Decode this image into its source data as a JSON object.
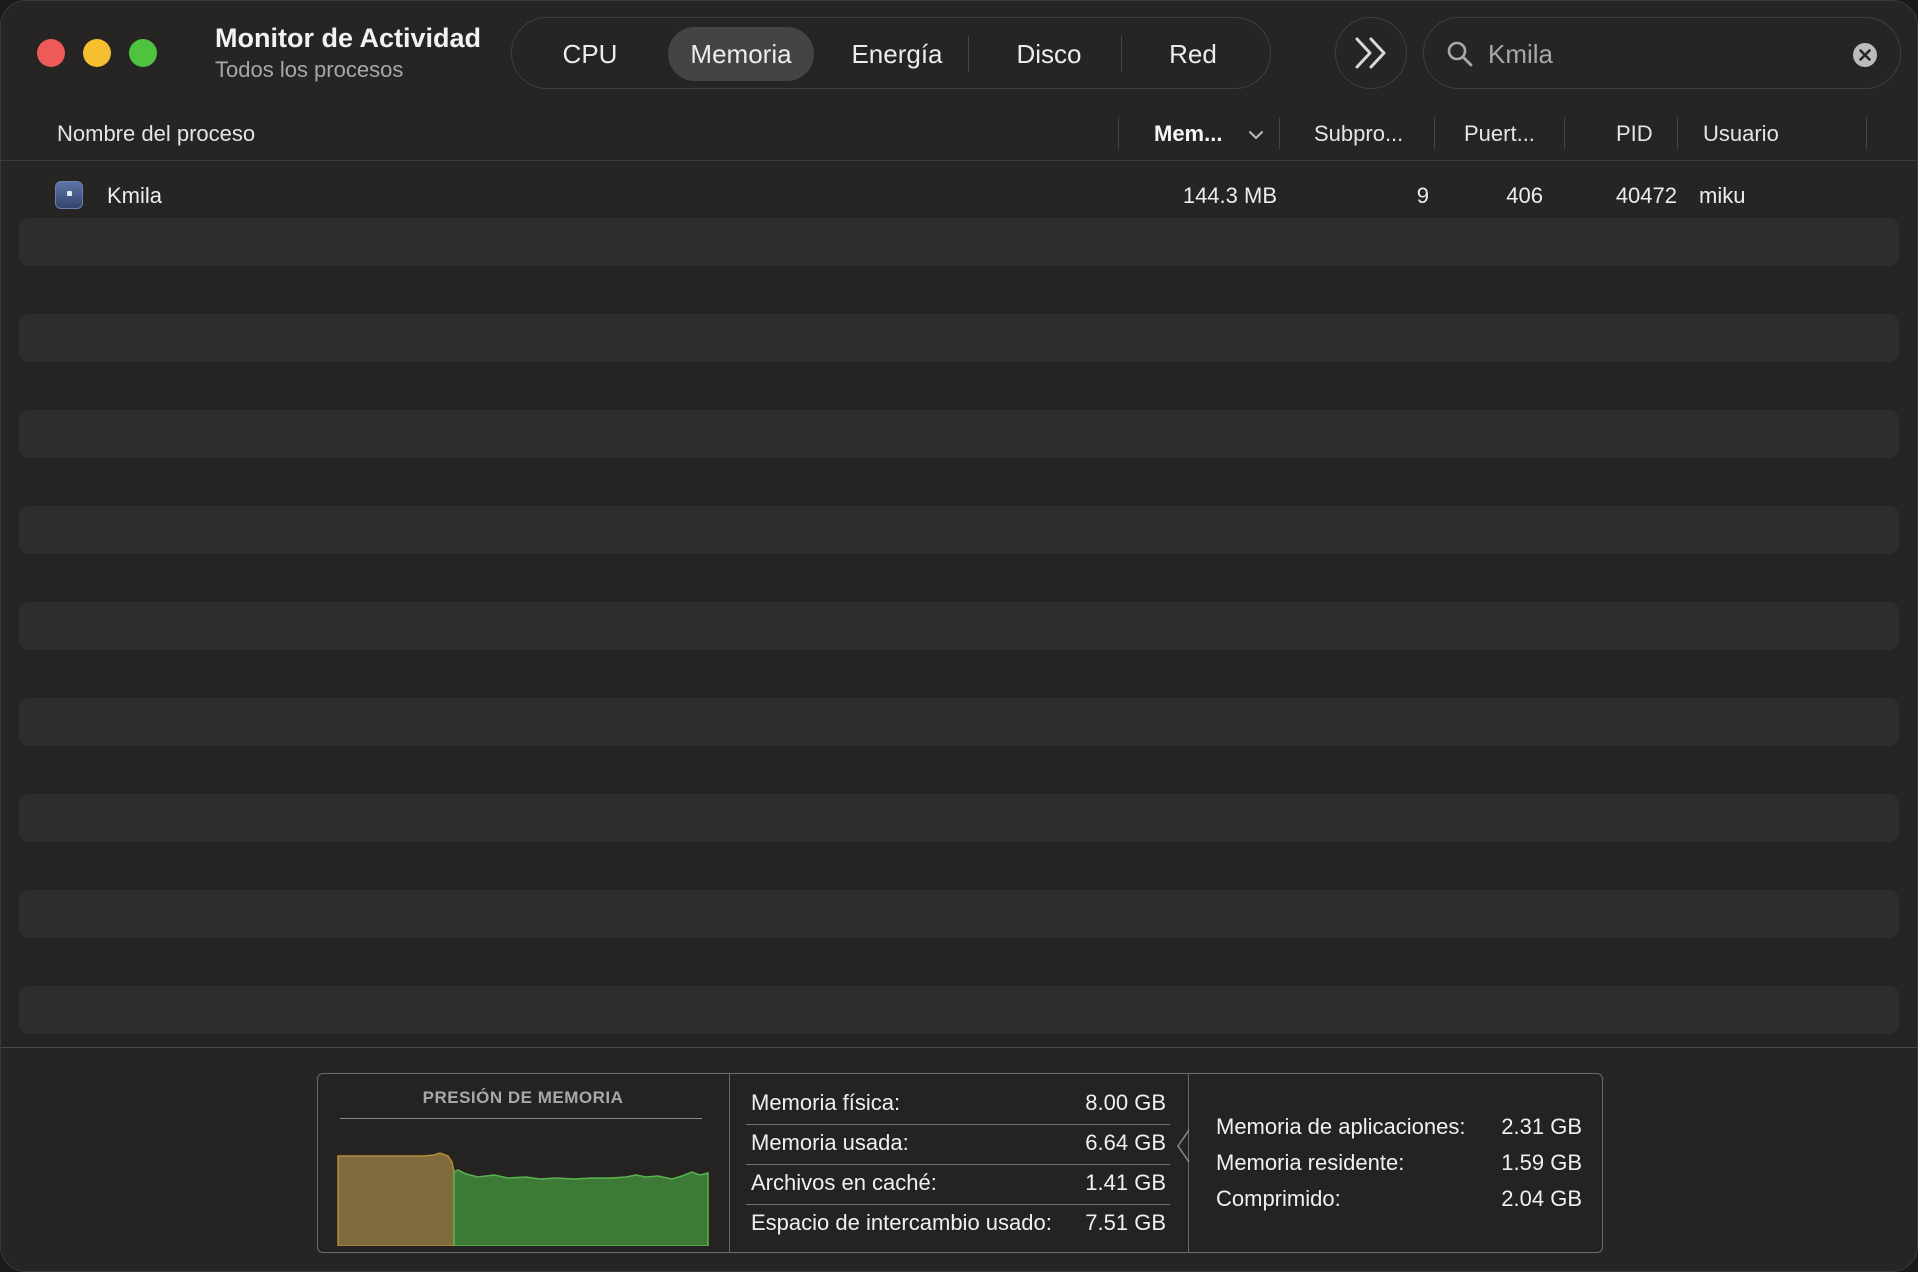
{
  "window": {
    "title": "Monitor de Actividad",
    "subtitle": "Todos los procesos"
  },
  "tabs": [
    {
      "label": "CPU",
      "active": false
    },
    {
      "label": "Memoria",
      "active": true
    },
    {
      "label": "Energía",
      "active": false
    },
    {
      "label": "Disco",
      "active": false
    },
    {
      "label": "Red",
      "active": false
    }
  ],
  "search": {
    "value": "Kmila"
  },
  "columns": {
    "name": "Nombre del proceso",
    "memory": "Mem...",
    "threads": "Subpro...",
    "ports": "Puert...",
    "pid": "PID",
    "user": "Usuario"
  },
  "process": {
    "name": "Kmila",
    "memory": "144.3 MB",
    "threads": "9",
    "ports": "406",
    "pid": "40472",
    "user": "miku"
  },
  "memory_pressure": {
    "title": "PRESIÓN DE MEMORIA"
  },
  "stats": {
    "physical_label": "Memoria física:",
    "physical_value": "8.00 GB",
    "used_label": "Memoria usada:",
    "used_value": "6.64 GB",
    "cached_label": "Archivos en caché:",
    "cached_value": "1.41 GB",
    "swap_label": "Espacio de intercambio usado:",
    "swap_value": "7.51 GB",
    "app_label": "Memoria de aplicaciones:",
    "app_value": "2.31 GB",
    "wired_label": "Memoria residente:",
    "wired_value": "1.59 GB",
    "compressed_label": "Comprimido:",
    "compressed_value": "2.04 GB"
  },
  "colors": {
    "pressure_yellow": "#806b3c",
    "pressure_green": "#3d7a38",
    "close": "#ee5b56",
    "minimize": "#f5bf2f",
    "maximize": "#4fc23f"
  }
}
